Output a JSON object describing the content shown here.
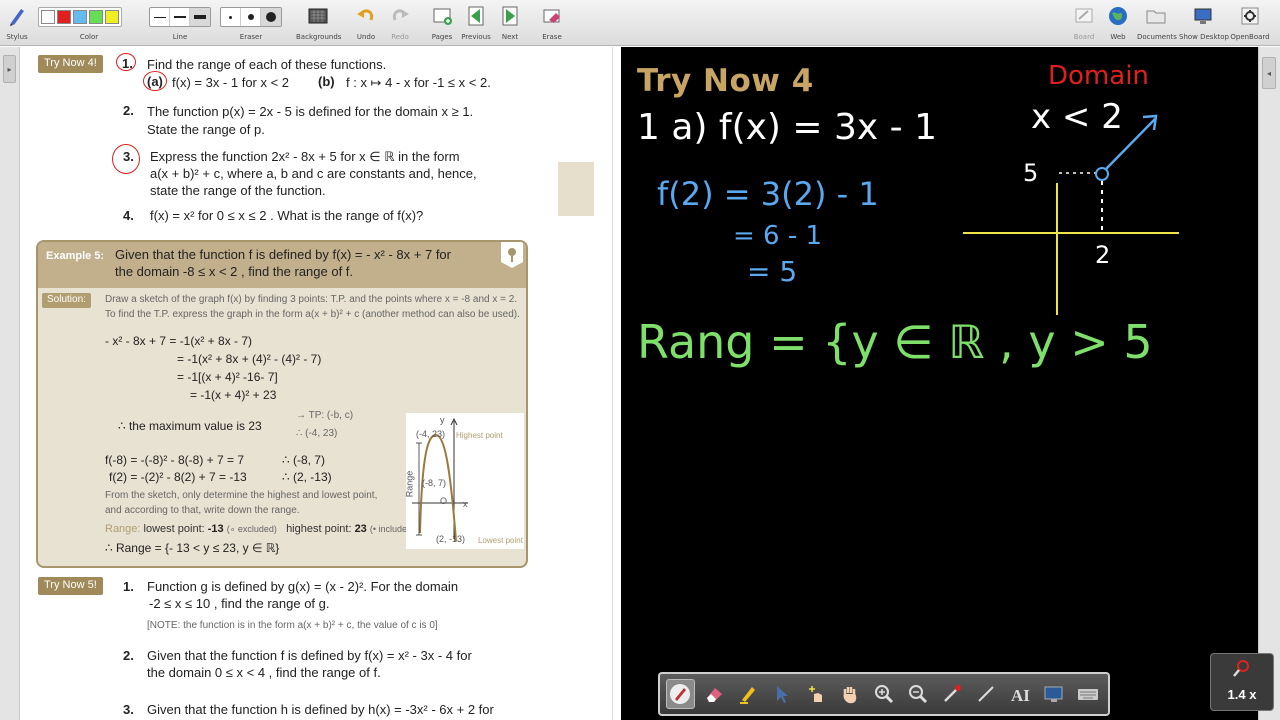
{
  "toolbar": {
    "stylus": "Stylus",
    "color": "Color",
    "line": "Line",
    "eraser_width": "Eraser",
    "backgrounds": "Backgrounds",
    "undo": "Undo",
    "redo": "Redo",
    "pages": "Pages",
    "previous": "Previous",
    "next": "Next",
    "erase": "Erase",
    "board": "Board",
    "web": "Web",
    "documents": "Documents",
    "show_desktop": "Show Desktop",
    "openboard": "OpenBoard",
    "palette_colors": [
      "#ffffff",
      "#e02020",
      "#66bbee",
      "#66dd55",
      "#eeee22"
    ]
  },
  "doc": {
    "try_now_4": {
      "tag": "Try Now 4!",
      "q1_num": "1.",
      "q1_text": "Find the range of each of these functions.",
      "q1a_label": "(a)",
      "q1a_text": "f(x) = 3x - 1  for x < 2",
      "q1b_label": "(b)",
      "q1b_text": "f : x ↦ 4 - x  for  -1 ≤ x < 2.",
      "q2_num": "2.",
      "q2_line1": "The function p(x) = 2x - 5 is defined for the domain  x ≥ 1.",
      "q2_line2": "State the range of p.",
      "q3_num": "3.",
      "q3_line1": "Express the function 2x² - 8x + 5 for  x ∈ ℝ  in the form",
      "q3_line2": "a(x + b)² + c, where a, b and c are constants and, hence,",
      "q3_line3": "state the range of the function.",
      "q4_num": "4.",
      "q4_text": "f(x) = x²  for  0 ≤ x ≤ 2 .  What is the range of f(x)?"
    },
    "example5": {
      "label": "Example 5:",
      "line1": "Given that the function f is defined by f(x) = - x² - 8x + 7 for",
      "line2": "the domain  -8 ≤ x < 2 , find the range of f.",
      "solution_label": "Solution:",
      "sol1": "Draw a sketch of the graph  f(x) by finding 3 points: T.P. and the points where x = -8 and x = 2.",
      "sol2": "To find the T.P. express the graph in the form a(x + b)² + c (another method can also be used).",
      "m1": "- x² - 8x + 7 = -1(x² + 8x - 7)",
      "m2": "= -1(x² + 8x + (4)² - (4)² - 7)",
      "m3": "= -1[(x + 4)² -16- 7]",
      "m4": "= -1(x + 4)² + 23",
      "max_line": "∴ the maximum value is 23",
      "tp1": "→ TP: (-b, c)",
      "tp2": "∴ (-4, 23)",
      "f1": "f(-8) = -(-8)² - 8(-8) + 7 = 7",
      "f1b": "∴  (-8, 7)",
      "f2": "f(2) = -(2)² - 8(2) + 7 = -13",
      "f2b": "∴  (2, -13)",
      "sketch1": "From the sketch, only determine the highest and lowest point,",
      "sketch2": "and according to that, write down the range.",
      "range_label": "Range:",
      "range_low": "lowest point:",
      "range_low_val": "-13",
      "range_low_note": "(∘ excluded)",
      "range_high": "highest point:",
      "range_high_val": "23",
      "range_high_note": "(• included)",
      "range_final": "∴  Range = {- 13 < y ≤ 23,  y ∈ ℝ}",
      "graph": {
        "y_axis": "y",
        "x_axis": "x",
        "origin": "O",
        "range_axis": "Range",
        "top_point": "(-4, 23)",
        "top_note": "Highest point",
        "mid_point": "(-8, 7)",
        "low_point": "(2, -13)",
        "low_note": "Lowest point"
      }
    },
    "try_now_5": {
      "tag": "Try Now 5!",
      "q1_num": "1.",
      "q1_line1": "Function g is defined by g(x) = (x - 2)².  For the domain",
      "q1_line2": "-2 ≤ x ≤ 10 , find the range of g.",
      "q1_note": "[NOTE: the function is in the form a(x + b)² + c, the value of c is 0]",
      "q2_num": "2.",
      "q2_line1": "Given that the function f is defined by f(x) = x² - 3x - 4 for",
      "q2_line2": "the domain  0 ≤ x < 4 , find the range of f.",
      "q3_num": "3.",
      "q3_line1": "Given that the function h is defined by h(x) = -3x² - 6x + 2 for"
    }
  },
  "board": {
    "title": "Try Now 4",
    "domain_word": "Domain",
    "domain_expr": "x < 2",
    "line1": "1 a)  f(x) = 3x - 1",
    "calc1": "f(2) = 3(2) - 1",
    "calc2": "= 6 - 1",
    "calc3": "= 5",
    "graph_y": "5",
    "graph_x": "2",
    "range_text": "Rang = {y ∈ ℝ ,   y > 5",
    "colors": {
      "title": "#c8a565",
      "white": "#ffffff",
      "blue": "#5aa8f0",
      "green": "#7ee06a",
      "yellow": "#f0e24a",
      "red": "#e02020"
    }
  },
  "float_tools": {
    "tools": [
      "pen-icon",
      "eraser-icon",
      "marker-icon",
      "selector-icon",
      "interactor-icon",
      "hand-icon",
      "zoom-in-icon",
      "zoom-out-icon",
      "pointer-icon",
      "line-icon",
      "text-icon",
      "capture-icon",
      "keyboard-icon"
    ]
  },
  "zoom": {
    "value": "1.4 x"
  }
}
